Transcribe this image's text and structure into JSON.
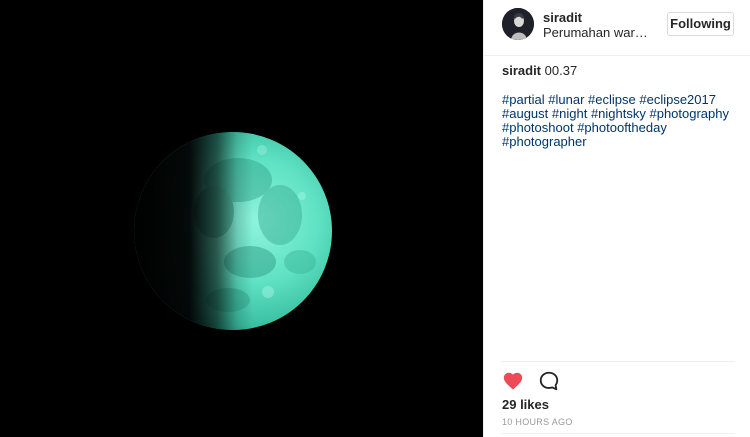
{
  "post": {
    "username": "siradit",
    "location": "Perumahan warta...",
    "follow_button_label": "Following",
    "caption_username": "siradit",
    "caption_text": "00.37",
    "hashtags": [
      "#partial",
      "#lunar",
      "#eclipse",
      "#eclipse2017",
      "#august",
      "#night",
      "#nightsky",
      "#photography",
      "#photoshoot",
      "#photooftheday",
      "#photographer"
    ],
    "likes_text": "29 likes",
    "timestamp": "10 HOURS AGO"
  },
  "icons": {
    "like": "heart-icon",
    "comment": "speech-bubble-icon"
  },
  "colors": {
    "like_red": "#ed4956",
    "hashtag_blue": "#003569",
    "moon_teal": "#5ae0c4",
    "photo_background": "#000000"
  }
}
